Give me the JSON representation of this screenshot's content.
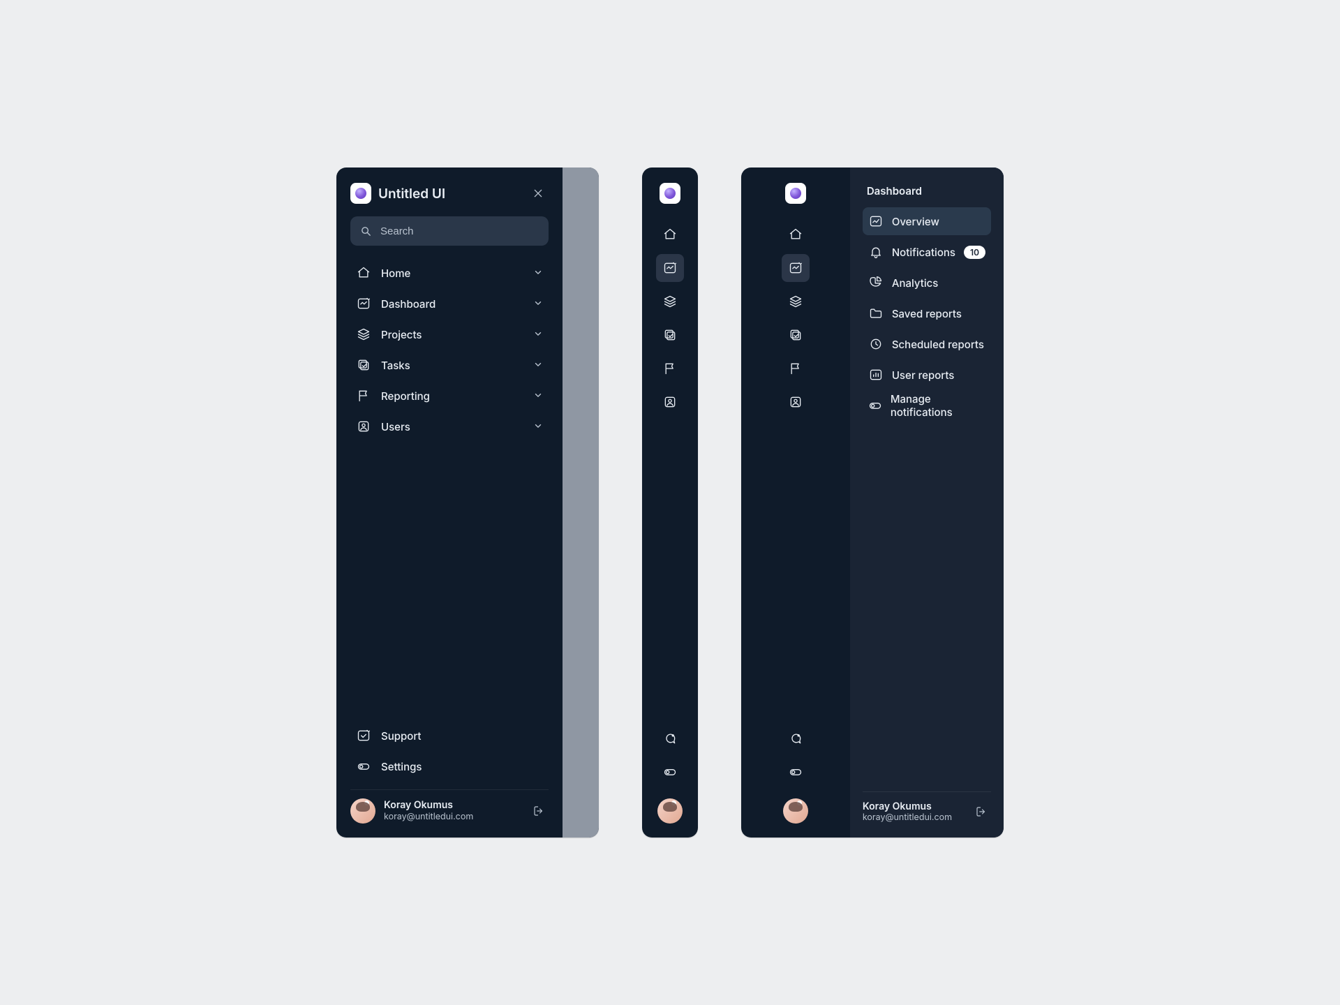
{
  "brand": "Untitled UI",
  "search_placeholder": "Search",
  "nav": {
    "home": "Home",
    "dashboard": "Dashboard",
    "projects": "Projects",
    "tasks": "Tasks",
    "reporting": "Reporting",
    "users": "Users"
  },
  "footer_nav": {
    "support": "Support",
    "settings": "Settings"
  },
  "user": {
    "name": "Koray Okumus",
    "email": "koray@untitledui.com"
  },
  "sub_panel": {
    "title": "Dashboard",
    "items": {
      "overview": "Overview",
      "notifications": "Notifications",
      "notifications_badge": "10",
      "analytics": "Analytics",
      "saved_reports": "Saved reports",
      "scheduled_reports": "Scheduled reports",
      "user_reports": "User reports",
      "manage_notifications": "Manage notifications"
    }
  }
}
